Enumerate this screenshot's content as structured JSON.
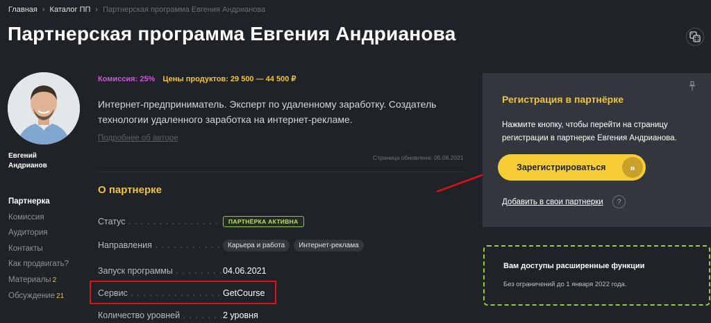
{
  "breadcrumb": {
    "items": [
      "Главная",
      "Каталог ПП",
      "Партнерская программа Евгения Андрианова"
    ],
    "separator": "›"
  },
  "page": {
    "title": "Партнерская программа Евгения Андрианова"
  },
  "icons": {
    "top_right": "dice-icon",
    "pin": "pin-icon",
    "arrow": "double-chevron-right-icon",
    "help": "question-icon"
  },
  "author": {
    "name_line1": "Евгений",
    "name_line2": "Андрианов"
  },
  "sidebar": {
    "items": [
      {
        "label": "Партнерка",
        "active": true,
        "count": ""
      },
      {
        "label": "Комиссия",
        "count": ""
      },
      {
        "label": "Аудитория",
        "count": ""
      },
      {
        "label": "Контакты",
        "count": ""
      },
      {
        "label": "Как продвигать?",
        "count": ""
      },
      {
        "label": "Материалы",
        "count": "2"
      },
      {
        "label": "Обсуждение",
        "count": "21"
      }
    ]
  },
  "stats": {
    "commission": "Комиссия: 25%",
    "prices": "Цены продуктов: 29 500 — 44 500 ₽"
  },
  "about": {
    "text": "Интернет-предприниматель. Эксперт по удаленному заработку. Создатель технологии удаленного заработка на интернет-рекламе.",
    "more_link": "Подробнее об авторе",
    "updated": "Страница обновлена: 05.08.2021"
  },
  "details": {
    "title": "О партнерке",
    "rows": [
      {
        "label": "Статус",
        "badge": "ПАРТНЁРКА АКТИВНА"
      },
      {
        "label": "Направления",
        "tags": [
          "Карьера и работа",
          "Интернет-реклама"
        ]
      },
      {
        "label": "Запуск программы",
        "value": "04.06.2021"
      },
      {
        "label": "Сервис",
        "value": "GetCourse"
      },
      {
        "label": "Количество уровней",
        "value": "2 уровня"
      }
    ]
  },
  "registration": {
    "title": "Регистрация в партнёрке",
    "description": "Нажмите кнопку, чтобы перейти на страницу регистрации в партнерке Евгения Андрианова.",
    "button_label": "Зарегистрироваться",
    "button_arrow": "»",
    "add_link": "Добавить в свои партнерки",
    "help": "?"
  },
  "extended": {
    "title": "Вам доступы расширенные функции",
    "description": "Без ограничений до 1 января 2022 года."
  },
  "colors": {
    "background": "#1f2226",
    "accent_yellow": "#f0c33c",
    "commission_purple": "#c85ad7",
    "active_green": "#8ec63f",
    "annotation_red": "#e0101a"
  }
}
